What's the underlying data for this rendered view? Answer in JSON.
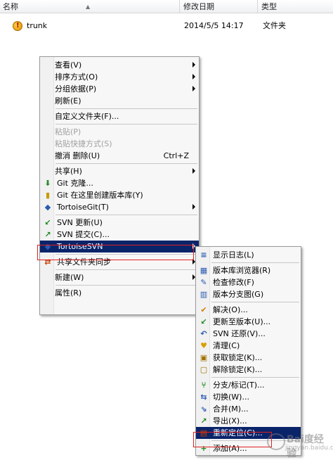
{
  "columns": {
    "name": "名称",
    "date": "修改日期",
    "type": "类型"
  },
  "file": {
    "name": "trunk",
    "date": "2014/5/5 14:17",
    "type": "文件夹"
  },
  "context_menu": [
    {
      "label": "查看(V)",
      "submenu": true
    },
    {
      "label": "排序方式(O)",
      "submenu": true
    },
    {
      "label": "分组依据(P)",
      "submenu": true
    },
    {
      "label": "刷新(E)"
    },
    {
      "sep": true
    },
    {
      "label": "自定义文件夹(F)..."
    },
    {
      "sep": true
    },
    {
      "label": "粘贴(P)",
      "disabled": true
    },
    {
      "label": "粘贴快捷方式(S)",
      "disabled": true
    },
    {
      "label": "撤消 删除(U)",
      "shortcut": "Ctrl+Z"
    },
    {
      "sep": true
    },
    {
      "label": "共享(H)",
      "submenu": true
    },
    {
      "label": "Git 克隆...",
      "icon": "git-clone-icon"
    },
    {
      "label": "Git 在这里创建版本库(Y)",
      "icon": "git-create-icon"
    },
    {
      "label": "TortoiseGit(T)",
      "icon": "tortoisegit-icon",
      "submenu": true
    },
    {
      "sep": true
    },
    {
      "label": "SVN 更新(U)",
      "icon": "svn-update-icon"
    },
    {
      "label": "SVN 提交(C)...",
      "icon": "svn-commit-icon"
    },
    {
      "label": "TortoiseSVN",
      "icon": "tortoisesvn-icon",
      "submenu": true,
      "highlighted": true
    },
    {
      "sep": true
    },
    {
      "label": "共享文件夹同步",
      "icon": "sync-icon",
      "submenu": true
    },
    {
      "sep": true
    },
    {
      "label": "新建(W)",
      "submenu": true
    },
    {
      "sep": true
    },
    {
      "label": "属性(R)"
    }
  ],
  "svn_menu": [
    {
      "label": "显示日志(L)",
      "icon": "log-icon"
    },
    {
      "sep": true
    },
    {
      "label": "版本库浏览器(R)",
      "icon": "repo-browser-icon"
    },
    {
      "label": "检查修改(F)",
      "icon": "check-modifications-icon"
    },
    {
      "label": "版本分支图(G)",
      "icon": "revision-graph-icon"
    },
    {
      "sep": true
    },
    {
      "label": "解决(O)...",
      "icon": "resolve-icon"
    },
    {
      "label": "更新至版本(U)...",
      "icon": "update-to-revision-icon"
    },
    {
      "label": "SVN 还原(V)...",
      "icon": "revert-icon"
    },
    {
      "label": "清理(C)",
      "icon": "cleanup-icon"
    },
    {
      "label": "获取锁定(K)...",
      "icon": "get-lock-icon"
    },
    {
      "label": "解除锁定(K)...",
      "icon": "release-lock-icon"
    },
    {
      "sep": true
    },
    {
      "label": "分支/标记(T)...",
      "icon": "branch-tag-icon"
    },
    {
      "label": "切换(W)...",
      "icon": "switch-icon"
    },
    {
      "label": "合并(M)...",
      "icon": "merge-icon"
    },
    {
      "label": "导出(X)...",
      "icon": "export-icon"
    },
    {
      "label": "重新定位(C)...",
      "icon": "relocate-icon",
      "highlighted": true
    },
    {
      "sep": true
    },
    {
      "label": "添加(A)...",
      "icon": "add-icon"
    }
  ],
  "watermark": {
    "text": "Bai度经验",
    "sub": "jingyan.baidu.com"
  },
  "colors": {
    "highlight": "#0a246a",
    "annotation": "#e02020"
  }
}
